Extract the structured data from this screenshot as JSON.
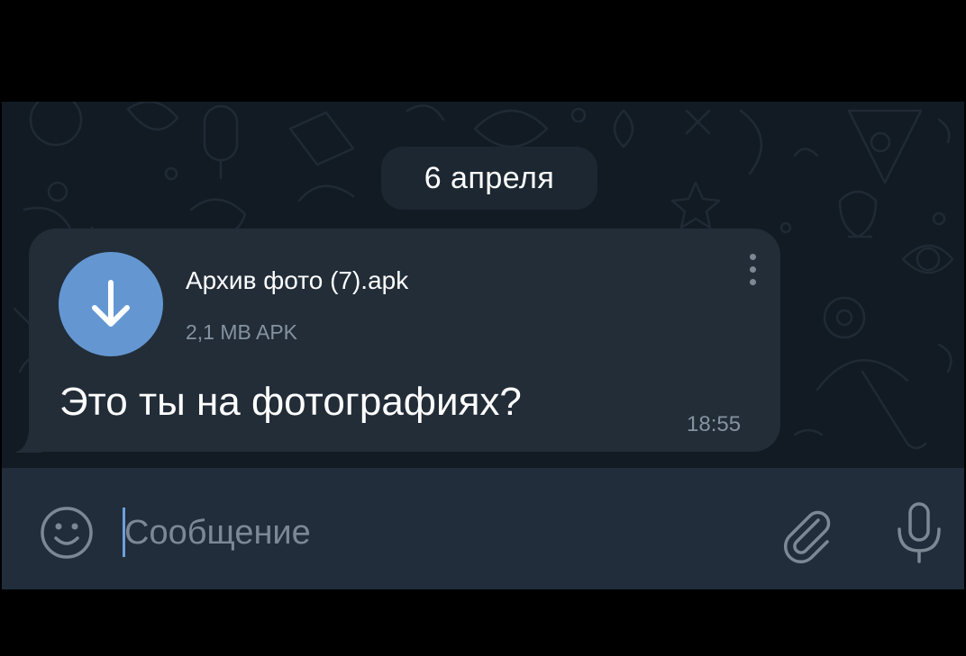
{
  "chat": {
    "date_separator": "6 апреля"
  },
  "message": {
    "file": {
      "name": "Архив фото (7).apk",
      "meta": "2,1 MB APK",
      "icon": "download-arrow-icon"
    },
    "text": "Это ты на фотографиях?",
    "time": "18:55"
  },
  "composer": {
    "placeholder": "Сообщение",
    "emoji_icon": "emoji-icon",
    "attach_icon": "paperclip-icon",
    "mic_icon": "microphone-icon"
  },
  "colors": {
    "background": "#121b24",
    "bubble": "#222d38",
    "accent": "#6497d2",
    "input_bar": "#212d3b",
    "secondary_text": "#8593a0"
  }
}
